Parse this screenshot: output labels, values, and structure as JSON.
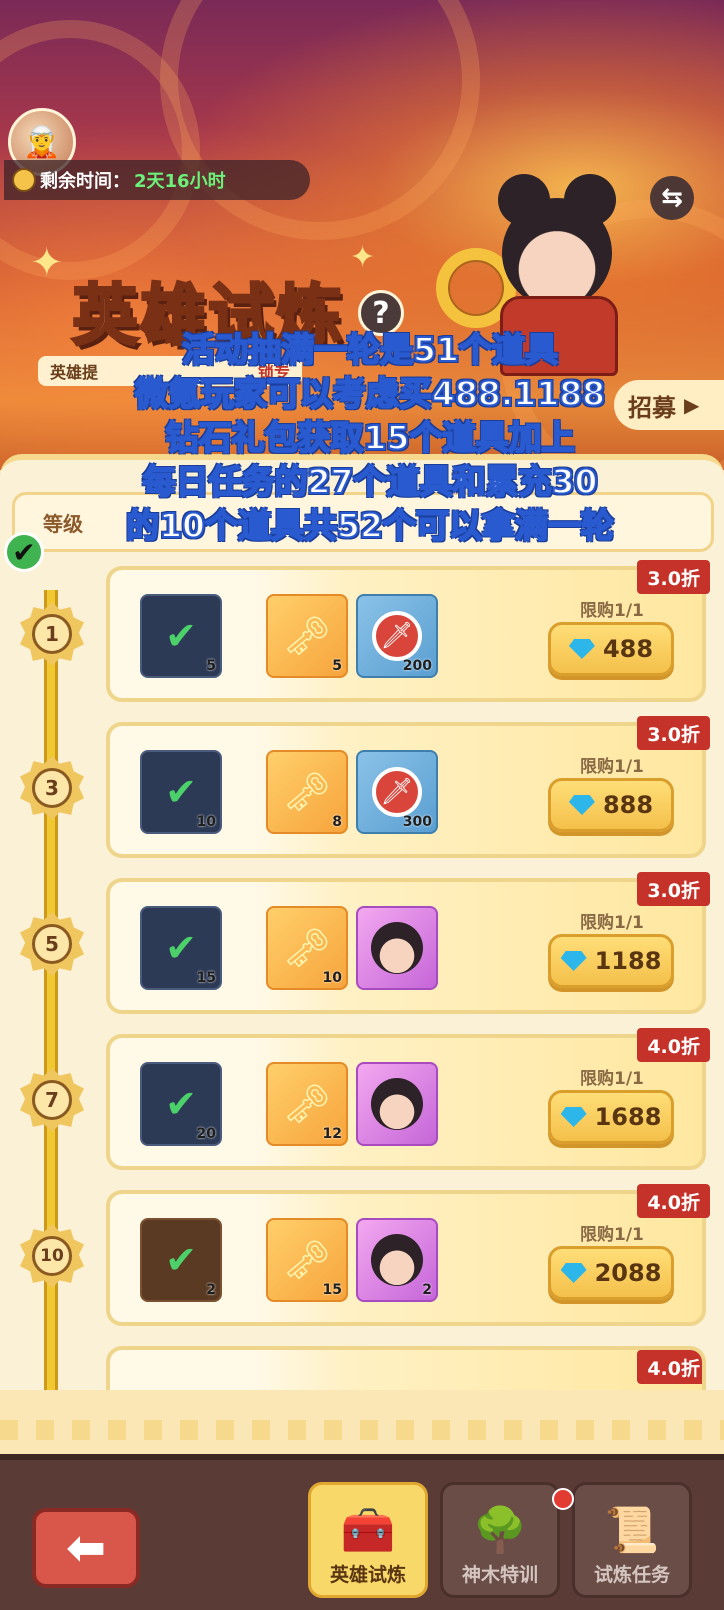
{
  "header": {
    "timer_label": "剩余时间：",
    "timer_value": "2天16小时",
    "title_part1": "英雄",
    "title_part2": "试炼",
    "sub_tag": "英雄提",
    "sub_tag_2": "锁专",
    "recruit_label": "招募"
  },
  "caption": {
    "lines": [
      "活动抽满一轮是51个道具",
      "微氪玩家可以考虑买488.1188",
      "钻石礼包获取15个道具加上",
      "每日任务的27个道具和累充30",
      "的10个道具共52个可以拿满一轮"
    ]
  },
  "filter": {
    "label": "等级"
  },
  "tiers": [
    {
      "level": "1",
      "discount": "3.0折",
      "book_qty": "5",
      "key_qty": "5",
      "third_type": "sword",
      "third_qty": "200",
      "limit": "限购1/1",
      "price": "488"
    },
    {
      "level": "3",
      "discount": "3.0折",
      "book_qty": "10",
      "key_qty": "8",
      "third_type": "sword",
      "third_qty": "300",
      "limit": "限购1/1",
      "price": "888"
    },
    {
      "level": "5",
      "discount": "3.0折",
      "book_qty": "15",
      "key_qty": "10",
      "third_type": "hero",
      "third_qty": "",
      "limit": "限购1/1",
      "price": "1188"
    },
    {
      "level": "7",
      "discount": "4.0折",
      "book_qty": "20",
      "key_qty": "12",
      "third_type": "hero",
      "third_qty": "",
      "limit": "限购1/1",
      "price": "1688"
    },
    {
      "level": "10",
      "discount": "4.0折",
      "book_qty": "2",
      "key_qty": "15",
      "third_type": "hero",
      "third_qty": "2",
      "limit": "限购1/1",
      "price": "2088"
    },
    {
      "level": "",
      "discount": "4.0折",
      "book_qty": "",
      "key_qty": "",
      "third_type": "hero",
      "third_qty": "",
      "limit": "",
      "price": ""
    }
  ],
  "nav": {
    "tabs": [
      {
        "label": "英雄试炼",
        "icon": "treasure-chest-icon",
        "active": true
      },
      {
        "label": "神木特训",
        "icon": "tree-icon",
        "active": false
      },
      {
        "label": "试炼任务",
        "icon": "scroll-quest-icon",
        "active": false
      }
    ]
  },
  "colors": {
    "discount_red": "#c5322a",
    "gem_blue": "#2cb6ea",
    "timer_green": "#6cf07a",
    "caption_stroke": "#2a5ad0"
  }
}
